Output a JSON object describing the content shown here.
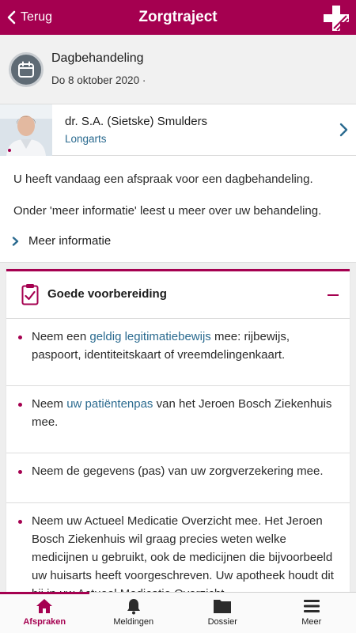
{
  "header": {
    "back_label": "Terug",
    "title": "Zorgtraject"
  },
  "appointment": {
    "type": "Dagbehandeling",
    "date": "Do 8 oktober 2020 ·"
  },
  "doctor": {
    "name": "dr. S.A. (Sietske) Smulders",
    "specialty": "Longarts"
  },
  "info": {
    "paragraph_1": "U heeft vandaag een afspraak voor een dagbehandeling.",
    "paragraph_2": "Onder 'meer informatie' leest u meer over uw behandeling.",
    "more_label": "Meer informatie"
  },
  "preparation": {
    "title": "Goede voorbereiding",
    "items": [
      {
        "before": "Neem een ",
        "link": "geldig legitimatiebewijs",
        "after": " mee: rijbewijs, paspoort, identiteitskaart of vreemdelingenkaart."
      },
      {
        "before": "Neem ",
        "link": "uw patiëntenpas",
        "after": " van het Jeroen Bosch Ziekenhuis mee."
      },
      {
        "text": "Neem de gegevens (pas) van uw zorgverzekering mee."
      },
      {
        "text": "Neem uw Actueel Medicatie Overzicht mee. Het Jeroen Bosch Ziekenhuis wil graag precies weten welke medicijnen u gebruikt, ook de medicijnen die bijvoorbeeld uw huisarts heeft voorgeschreven. Uw apotheek houdt dit bij in uw Actueel Medicatie Overzicht."
      }
    ]
  },
  "tabs": [
    {
      "label": "Afspraken",
      "icon": "home-icon",
      "active": true
    },
    {
      "label": "Meldingen",
      "icon": "bell-icon",
      "active": false
    },
    {
      "label": "Dossier",
      "icon": "folder-icon",
      "active": false
    },
    {
      "label": "Meer",
      "icon": "menu-icon",
      "active": false
    }
  ],
  "colors": {
    "brand": "#a50050",
    "link": "#2a6a8f"
  }
}
